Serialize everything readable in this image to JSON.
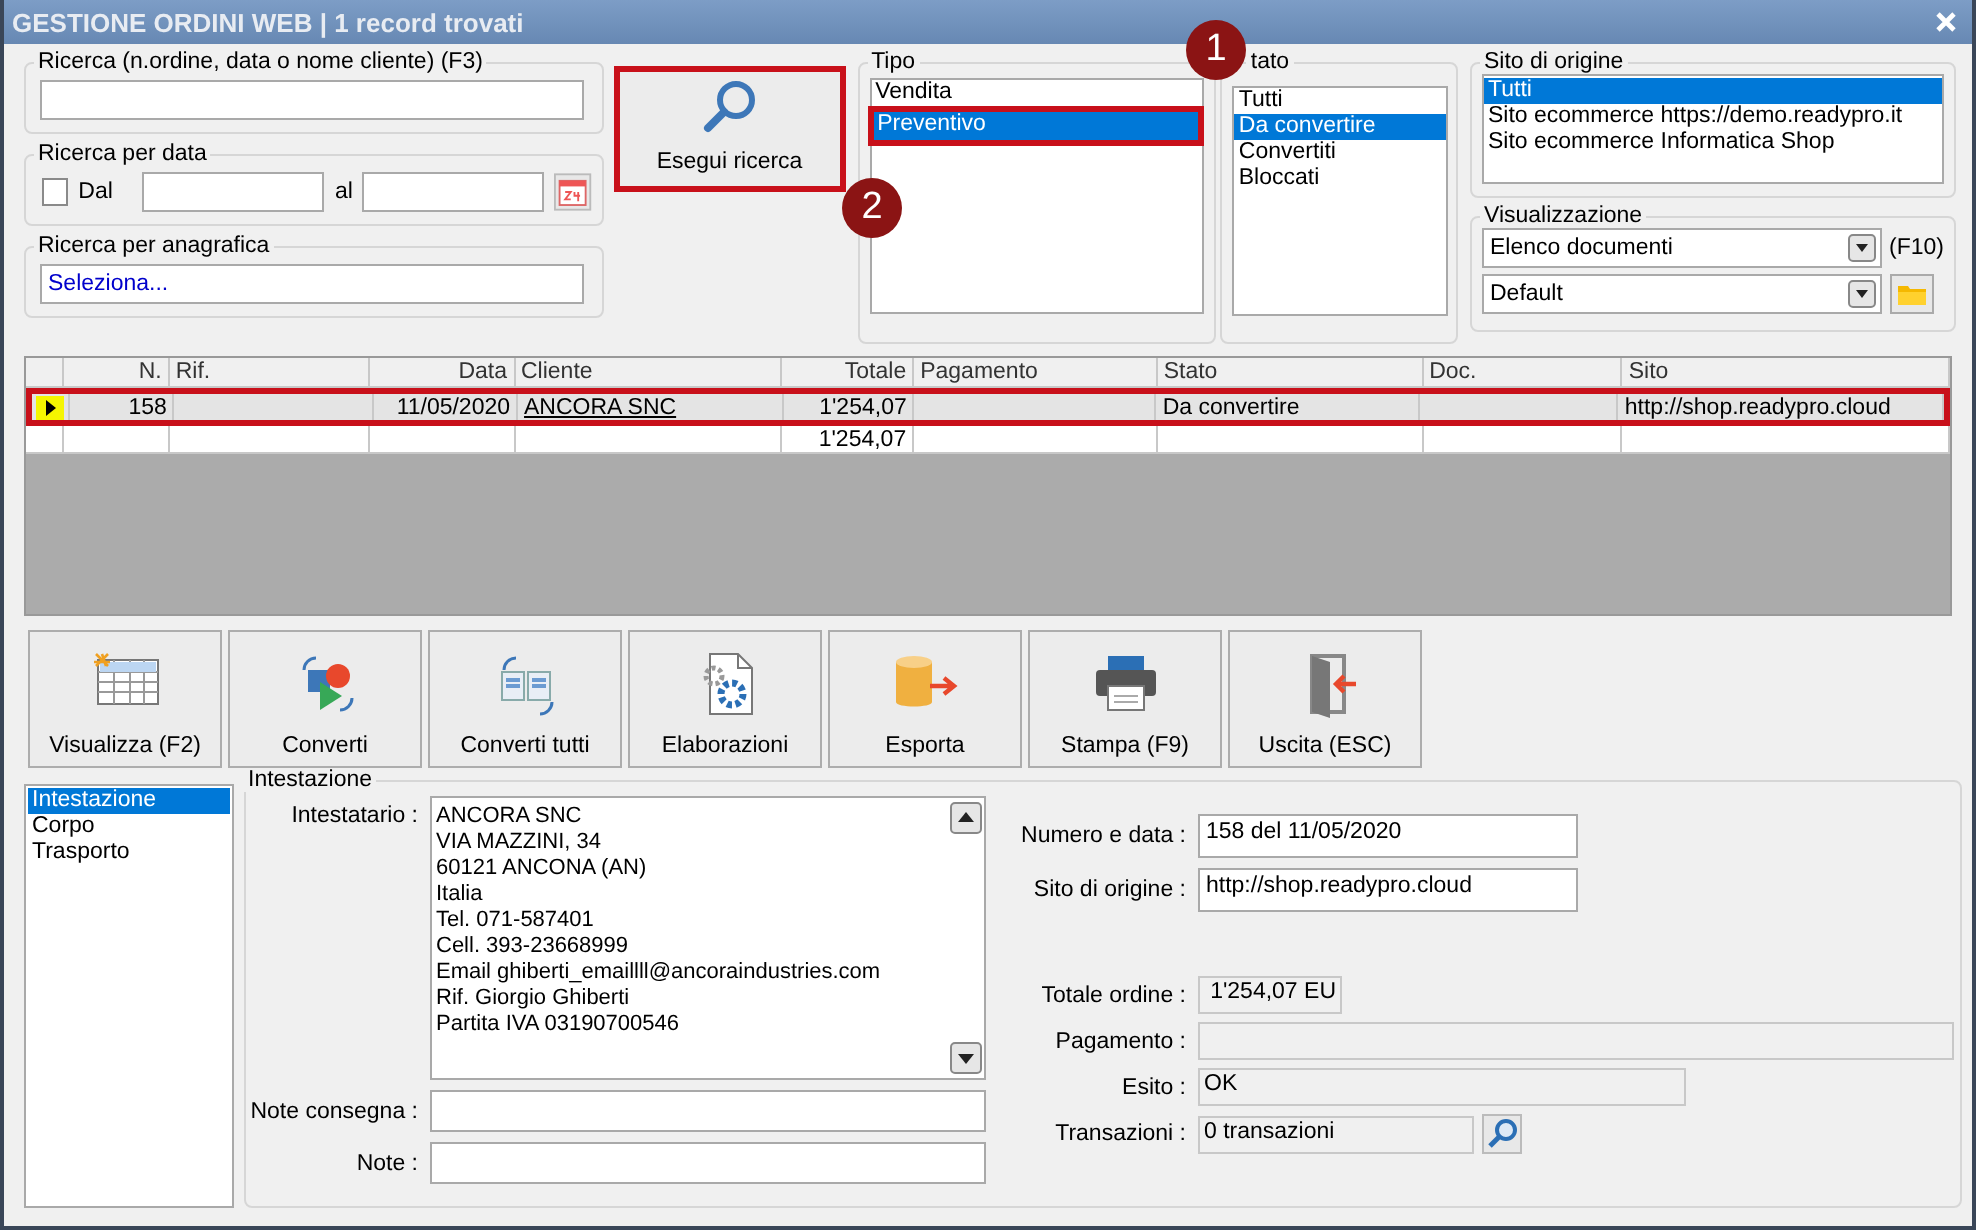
{
  "window": {
    "title": "GESTIONE ORDINI WEB | 1 record trovati"
  },
  "search": {
    "label": "Ricerca (n.ordine, data o nome cliente) (F3)"
  },
  "date_search": {
    "label": "Ricerca per data",
    "checkbox_label": "Dal",
    "checked": false,
    "to_label": "al"
  },
  "registry_search": {
    "label": "Ricerca per anagrafica",
    "value": "Seleziona..."
  },
  "search_button": {
    "label": "Esegui ricerca",
    "highlighted": true
  },
  "tipo": {
    "label": "Tipo",
    "items": [
      {
        "label": "Vendita",
        "selected": false,
        "highlighted": false
      },
      {
        "label": "Preventivo",
        "selected": true,
        "highlighted": true
      }
    ]
  },
  "stato": {
    "label": "tato",
    "items": [
      {
        "label": "Tutti",
        "selected": false
      },
      {
        "label": "Da convertire",
        "selected": true
      },
      {
        "label": "Convertiti",
        "selected": false
      },
      {
        "label": "Bloccati",
        "selected": false
      }
    ]
  },
  "sito_origine": {
    "label": "Sito di origine",
    "items": [
      {
        "label": "Tutti",
        "selected": true
      },
      {
        "label": "Sito ecommerce https://demo.readypro.it",
        "selected": false
      },
      {
        "label": "Sito ecommerce Informatica Shop",
        "selected": false
      }
    ]
  },
  "visualizzazione": {
    "label": "Visualizzazione",
    "selects": [
      {
        "value": "Elenco documenti",
        "shortcut": "(F10)"
      },
      {
        "value": "Default"
      }
    ]
  },
  "annotations": [
    {
      "number": "1"
    },
    {
      "number": "2"
    }
  ],
  "table": {
    "columns": [
      {
        "label": "N."
      },
      {
        "label": "Rif."
      },
      {
        "label": "Data"
      },
      {
        "label": "Cliente"
      },
      {
        "label": "Totale",
        "total": "1'254,07"
      },
      {
        "label": "Pagamento"
      },
      {
        "label": "Stato"
      },
      {
        "label": "Doc."
      },
      {
        "label": "Sito"
      }
    ],
    "rows": [
      {
        "current": true,
        "highlighted": true,
        "cells": [
          {
            "text": "158"
          },
          {},
          {
            "text": "11/05/2020"
          },
          {
            "text": "ANCORA SNC"
          },
          {
            "text": "1'254,07"
          },
          {},
          {
            "text": "Da convertire"
          },
          {},
          {
            "text": "http://shop.readypro.cloud"
          }
        ]
      }
    ]
  },
  "toolbar": [
    {
      "label": "Visualizza (F2)",
      "kind": "view"
    },
    {
      "label": "Converti",
      "kind": "convert"
    },
    {
      "label": "Converti tutti",
      "kind": "convert_all"
    },
    {
      "label": "Elaborazioni",
      "kind": "process"
    },
    {
      "label": "Esporta",
      "kind": "export"
    },
    {
      "label": "Stampa (F9)",
      "kind": "print"
    },
    {
      "label": "Uscita (ESC)",
      "kind": "exit"
    }
  ],
  "detail_nav": [
    {
      "label": "Intestazione",
      "selected": true
    },
    {
      "label": "Corpo",
      "selected": false
    },
    {
      "label": "Trasporto",
      "selected": false
    }
  ],
  "intestazione": {
    "title": "Intestazione",
    "holder_label": "Intestatario :",
    "holder_lines": [
      "ANCORA SNC",
      "VIA MAZZINI, 34",
      "60121 ANCONA (AN)",
      "Italia",
      "Tel. 071-587401",
      "Cell. 393-23668999",
      "Email ghiberti_emaillll@ancoraindustries.com",
      "Rif. Giorgio Ghiberti",
      "Partita IVA 03190700546"
    ],
    "notes": [
      {
        "label": "Note consegna :"
      },
      {
        "label": "Note :"
      }
    ],
    "order_fields": [
      {
        "label": "Numero e data :",
        "value": "158 del 11/05/2020",
        "kind": "input"
      },
      {
        "label": "Sito di origine :",
        "value": "http://shop.readypro.cloud",
        "kind": "input"
      }
    ],
    "payment_fields": [
      {
        "label": "Totale ordine :",
        "value": "1'254,07 EU",
        "kind": "amount"
      },
      {
        "label": "Pagamento :",
        "kind": "readonly_wide"
      },
      {
        "label": "Esito :",
        "value": "OK",
        "kind": "readonly"
      },
      {
        "label": "Transazioni :",
        "value": "0 transazioni",
        "kind": "lookup"
      }
    ]
  }
}
